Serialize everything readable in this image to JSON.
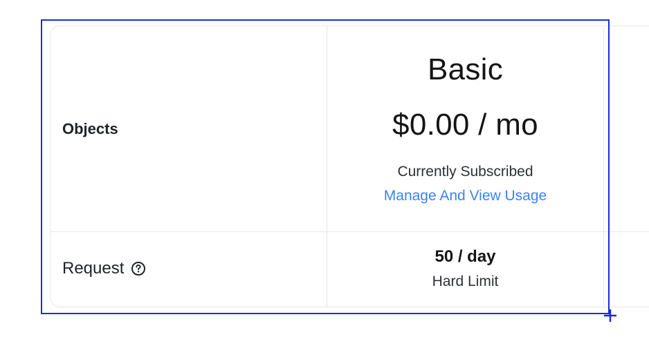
{
  "table": {
    "header_row": {
      "label": "Objects",
      "plan": {
        "name": "Basic",
        "price": "$0.00 / mo",
        "status": "Currently Subscribed",
        "manage_link": "Manage And View Usage"
      }
    },
    "rows": [
      {
        "label": "Request",
        "label_icon": "help-circle-icon",
        "value": "50 / day",
        "sub": "Hard Limit"
      }
    ]
  },
  "colors": {
    "link": "#3c82f6",
    "selection": "#1a2bd8",
    "border": "#e3e6ea"
  }
}
